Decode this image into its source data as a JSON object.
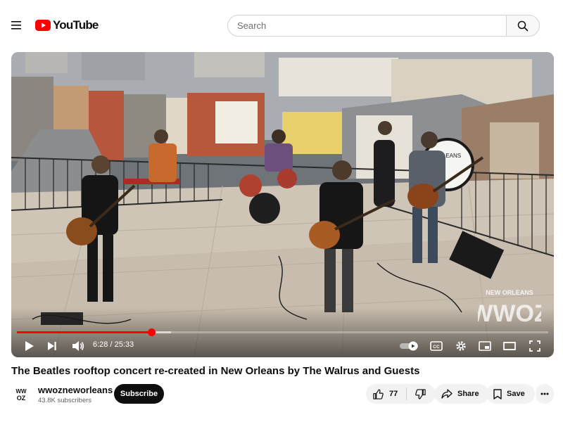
{
  "header": {
    "logo_text": "YouTube",
    "search_placeholder": "Search"
  },
  "player": {
    "current_time": "6:28",
    "duration": "25:33",
    "time_separator": "/",
    "progress_fraction": 0.253,
    "buffered_fraction": 0.29,
    "watermark_text": "NEW ORLEANS",
    "watermark_logo": "WWOZ",
    "drum_banner_text": "ORLEANS"
  },
  "video": {
    "title": "The Beatles rooftop concert re-created in New Orleans by The Walrus and Guests"
  },
  "channel": {
    "name": "wwozneworleans",
    "subscribers": "43.8K subscribers",
    "avatar_text": "WWOZ",
    "subscribe_label": "Subscribe"
  },
  "actions": {
    "like_count": "77",
    "share_label": "Share",
    "save_label": "Save"
  },
  "colors": {
    "brand_red": "#ff0000",
    "text_primary": "#0f0f0f",
    "text_secondary": "#606060",
    "pill_bg": "#f2f2f2"
  },
  "icons": [
    "menu-icon",
    "youtube-logo-icon",
    "search-icon",
    "play-icon",
    "next-icon",
    "volume-icon",
    "autoplay-toggle-icon",
    "captions-icon",
    "settings-icon",
    "miniplayer-icon",
    "theater-icon",
    "fullscreen-icon",
    "like-icon",
    "dislike-icon",
    "share-icon",
    "save-icon",
    "more-icon"
  ]
}
